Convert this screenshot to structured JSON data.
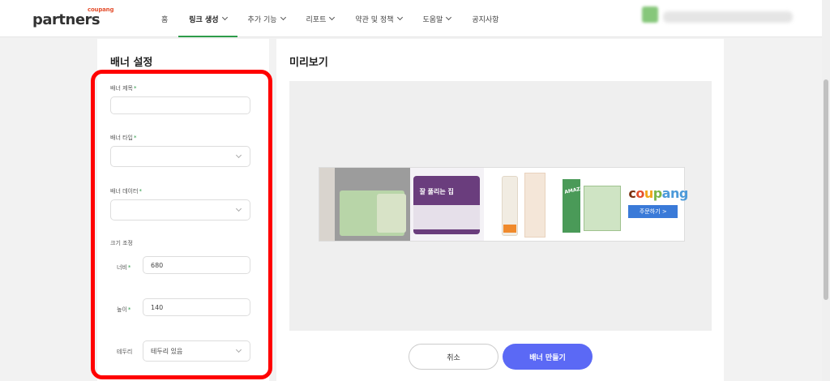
{
  "header": {
    "logo_small": "coupang",
    "logo_big": "partners",
    "nav": [
      {
        "label": "홈",
        "dropdown": false,
        "active": false
      },
      {
        "label": "링크 생성",
        "dropdown": true,
        "active": true
      },
      {
        "label": "추가 기능",
        "dropdown": true,
        "active": false
      },
      {
        "label": "리포트",
        "dropdown": true,
        "active": false
      },
      {
        "label": "약관 및 정책",
        "dropdown": true,
        "active": false
      },
      {
        "label": "도움말",
        "dropdown": true,
        "active": false
      },
      {
        "label": "공지사항",
        "dropdown": false,
        "active": false
      }
    ]
  },
  "banner_settings": {
    "title": "배너 설정",
    "banner_title_label": "배너 제목",
    "banner_title_value": "",
    "banner_type_label": "배너 타입",
    "banner_type_value": "",
    "banner_data_label": "배너 데이터",
    "banner_data_value": "",
    "size_label": "크기 조정",
    "width_label": "너비",
    "width_value": "680",
    "height_label": "높이",
    "height_value": "140",
    "border_label": "테두리",
    "border_value": "테두리 있음",
    "required_mark": "*"
  },
  "preview": {
    "title": "미리보기",
    "product_text": "잘 풀리는 집",
    "carton_text": "AMAZING OAT",
    "brand_letters": [
      "c",
      "o",
      "u",
      "p",
      "ang"
    ],
    "order_button": "주문하기 >"
  },
  "actions": {
    "cancel": "취소",
    "create": "배너 만들기"
  },
  "colors": {
    "accent_green": "#2e9c4a",
    "primary_button": "#5b69f5",
    "highlight_red": "#ff0000"
  }
}
